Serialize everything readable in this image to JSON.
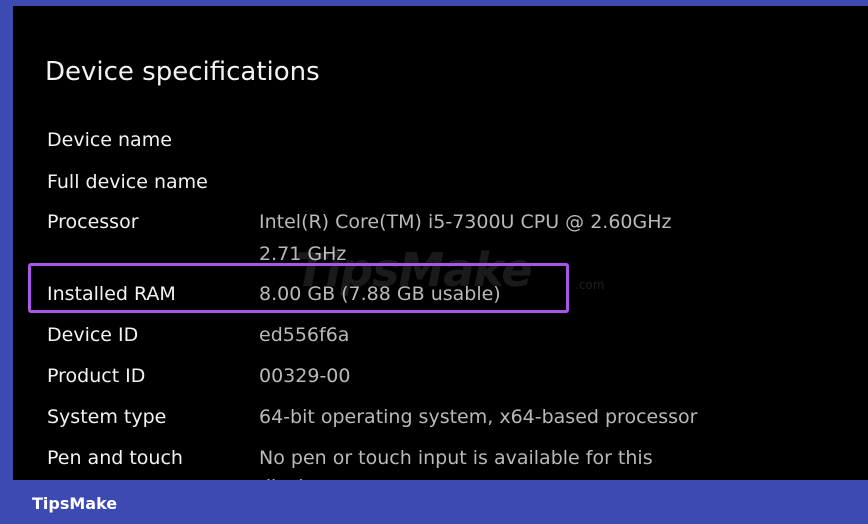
{
  "section_title": "Device specifications",
  "specs": [
    {
      "label": "Device name",
      "value": ""
    },
    {
      "label": "Full device name",
      "value": ""
    },
    {
      "label": "Processor",
      "value": "Intel(R) Core(TM) i5-7300U CPU @ 2.60GHz",
      "value_line2": "2.71 GHz"
    },
    {
      "label": "Installed RAM",
      "value": "8.00 GB (7.88 GB usable)"
    },
    {
      "label": "Device ID",
      "value": "ed556f6a"
    },
    {
      "label": "Product ID",
      "value": "00329-00"
    },
    {
      "label": "System type",
      "value": "64-bit operating system, x64-based processor"
    },
    {
      "label": "Pen and touch",
      "value": "No pen or touch input is available for this",
      "value_line2": "display"
    }
  ],
  "watermark": {
    "text": "TipsMake",
    "suffix": ".com"
  },
  "footer": {
    "brand": "TipsMake"
  },
  "colors": {
    "frame": "#3d4ab2",
    "background": "#000000",
    "label_text": "#f2f2f2",
    "value_text": "#b9b9b9",
    "highlight_border": "#a855e8"
  }
}
